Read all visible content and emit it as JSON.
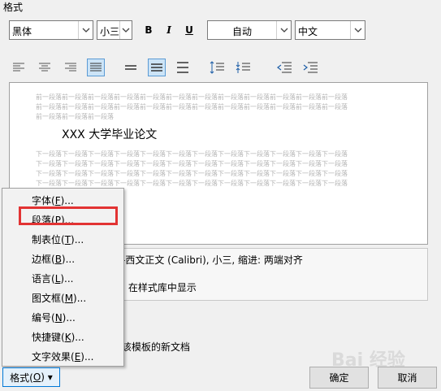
{
  "section_title": "格式",
  "toolbar": {
    "font_value": "黑体",
    "size_value": "小三",
    "bold_label": "B",
    "italic_label": "I",
    "underline_label": "U",
    "color_value": "自动",
    "language_value": "中文"
  },
  "preview": {
    "prev_lines": [
      "前一段落前一段落前一段落前一段落前一段落前一段落前一段落前一段落前一段落前一段落前一段落前一段落",
      "前一段落前一段落前一段落前一段落前一段落前一段落前一段落前一段落前一段落前一段落前一段落前一段落",
      "前一段落前一段落前一段落"
    ],
    "sample_text": "XXX 大学毕业论文",
    "next_lines": [
      "下一段落下一段落下一段落下一段落下一段落下一段落下一段落下一段落下一段落下一段落下一段落下一段落",
      "下一段落下一段落下一段落下一段落下一段落下一段落下一段落下一段落下一段落下一段落下一段落下一段落",
      "下一段落下一段落下一段落下一段落下一段落下一段落下一段落下一段落下一段落下一段落下一段落下一段落",
      "下一段落下一段落下一段落下一段落下一段落下一段落下一段落下一段落下一段落下一段落下一段落下一段落"
    ]
  },
  "description": {
    "line1": "-西文正文 (Calibri), 小三, 缩进: 两端对齐",
    "line2": ": 在样式库中显示"
  },
  "template_text": "该模板的新文档",
  "menu": {
    "items": [
      "字体(F)...",
      "段落(P)...",
      "制表位(T)...",
      "边框(B)...",
      "语言(L)...",
      "图文框(M)...",
      "编号(N)...",
      "快捷键(K)...",
      "文字效果(E)..."
    ]
  },
  "buttons": {
    "format": "格式(O) ▾",
    "ok": "确定",
    "cancel": "取消"
  },
  "watermark": "Bai 经验",
  "colors": {
    "highlight_box": "#e23333",
    "active_button": "#cce4f7"
  }
}
